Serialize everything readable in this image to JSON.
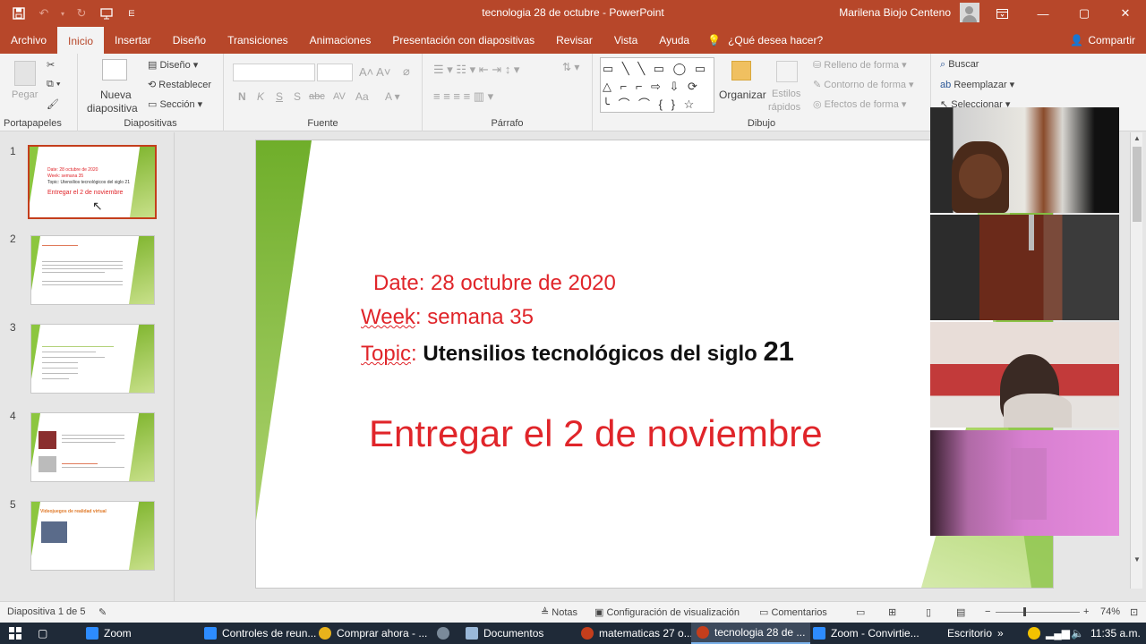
{
  "window": {
    "title": "tecnologia 28 de octubre  -  PowerPoint",
    "user": "Marilena Biojo Centeno",
    "minimize": "—",
    "maximize": "▢",
    "close": "✕"
  },
  "tabs": [
    {
      "label": "Archivo"
    },
    {
      "label": "Inicio"
    },
    {
      "label": "Insertar"
    },
    {
      "label": "Diseño"
    },
    {
      "label": "Transiciones"
    },
    {
      "label": "Animaciones"
    },
    {
      "label": "Presentación con diapositivas"
    },
    {
      "label": "Revisar"
    },
    {
      "label": "Vista"
    },
    {
      "label": "Ayuda"
    }
  ],
  "tell_me": "¿Qué desea hacer?",
  "share": "Compartir",
  "ribbon": {
    "clipboard": {
      "label": "Portapapeles",
      "paste": "Pegar"
    },
    "slides": {
      "label": "Diapositivas",
      "new_slide_1": "Nueva",
      "new_slide_2": "diapositiva",
      "layout": "Diseño",
      "reset": "Restablecer",
      "section": "Sección"
    },
    "font": {
      "label": "Fuente",
      "bold": "N",
      "italic": "K",
      "underline": "S",
      "shadow": "S",
      "strike": "abc",
      "spacing": "AV",
      "case": "Aa"
    },
    "paragraph": {
      "label": "Párrafo"
    },
    "drawing": {
      "label": "Dibujo",
      "arrange": "Organizar",
      "styles_1": "Estilos",
      "styles_2": "rápidos",
      "fill": "Relleno de forma",
      "outline": "Contorno de forma",
      "effects": "Efectos de forma"
    },
    "editing": {
      "find": "Buscar",
      "replace": "Reemplazar",
      "select": "Seleccionar"
    }
  },
  "thumbnails": [
    {
      "num": "1",
      "title": "Entregar el 2 de noviembre",
      "line1": "Date: 28 octubre de 2020",
      "line2": "Week: semana 35",
      "line3": "Topic: Utensilios tecnológicos del siglo 21"
    },
    {
      "num": "2",
      "title": ""
    },
    {
      "num": "3",
      "title": ""
    },
    {
      "num": "4",
      "title": ""
    },
    {
      "num": "5",
      "title": "Videojuegos de realidad virtual"
    }
  ],
  "slide": {
    "date_label": "Date",
    "date_value": ": 28 octubre de 2020",
    "week_label": "Week",
    "week_value": ": semana 35",
    "topic_label": "Topic",
    "topic_sep": ": ",
    "topic_value": "Utensilios tecnológicos del siglo ",
    "topic_num": "21",
    "deadline": "Entregar el 2 de noviembre"
  },
  "status": {
    "slide_info": "Diapositiva 1 de 5",
    "notes": "Notas",
    "view_settings": "Configuración de visualización",
    "comments": "Comentarios",
    "zoom_minus": "−",
    "zoom_plus": "+",
    "zoom": "74%"
  },
  "taskbar": {
    "items": [
      {
        "label": "Zoom"
      },
      {
        "label": "Controles de reun..."
      },
      {
        "label": "Comprar ahora - ..."
      },
      {
        "label": "Documentos"
      },
      {
        "label": "matematicas 27 o..."
      },
      {
        "label": "tecnologia 28 de ..."
      },
      {
        "label": "Zoom - Convirtie..."
      }
    ],
    "desktop": "Escritorio",
    "more": "»",
    "time": "11:35 a.m."
  },
  "colors": {
    "accent": "#b7472a",
    "slide_red": "#e0252a",
    "slide_green": "#8bc34a"
  }
}
